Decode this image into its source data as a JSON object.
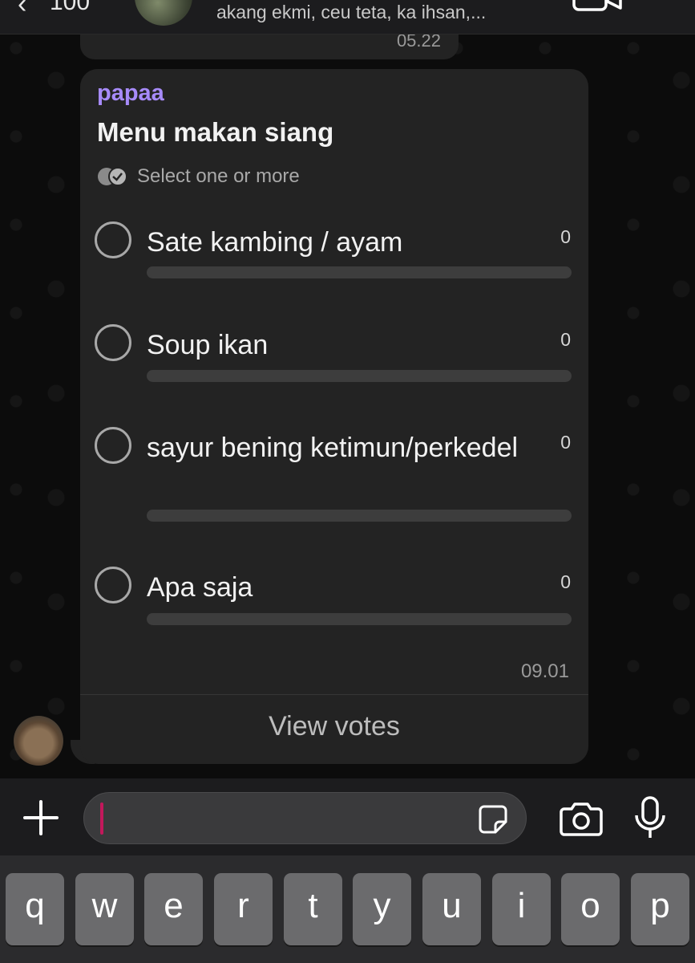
{
  "header": {
    "back_count": "100",
    "subtitle": "akang ekmi, ceu teta, ka ihsan,..."
  },
  "previous_message": {
    "time": "05.22"
  },
  "poll": {
    "sender": "papaa",
    "title": "Menu makan siang",
    "hint": "Select one or more",
    "options": [
      {
        "label": "Sate kambing / ayam",
        "count": "0",
        "fraction": 0
      },
      {
        "label": "Soup ikan",
        "count": "0",
        "fraction": 0
      },
      {
        "label": "sayur bening ketimun/perkedel",
        "count": "0",
        "fraction": 0
      },
      {
        "label": "Apa saja",
        "count": "0",
        "fraction": 0
      }
    ],
    "time": "09.01",
    "view_votes": "View votes"
  },
  "keyboard": {
    "keys": [
      "q",
      "w",
      "e",
      "r",
      "t",
      "y",
      "u",
      "i",
      "o",
      "p"
    ]
  },
  "colors": {
    "sender": "#a78bfa",
    "cursor": "#c2185b",
    "bubble": "#232323"
  }
}
